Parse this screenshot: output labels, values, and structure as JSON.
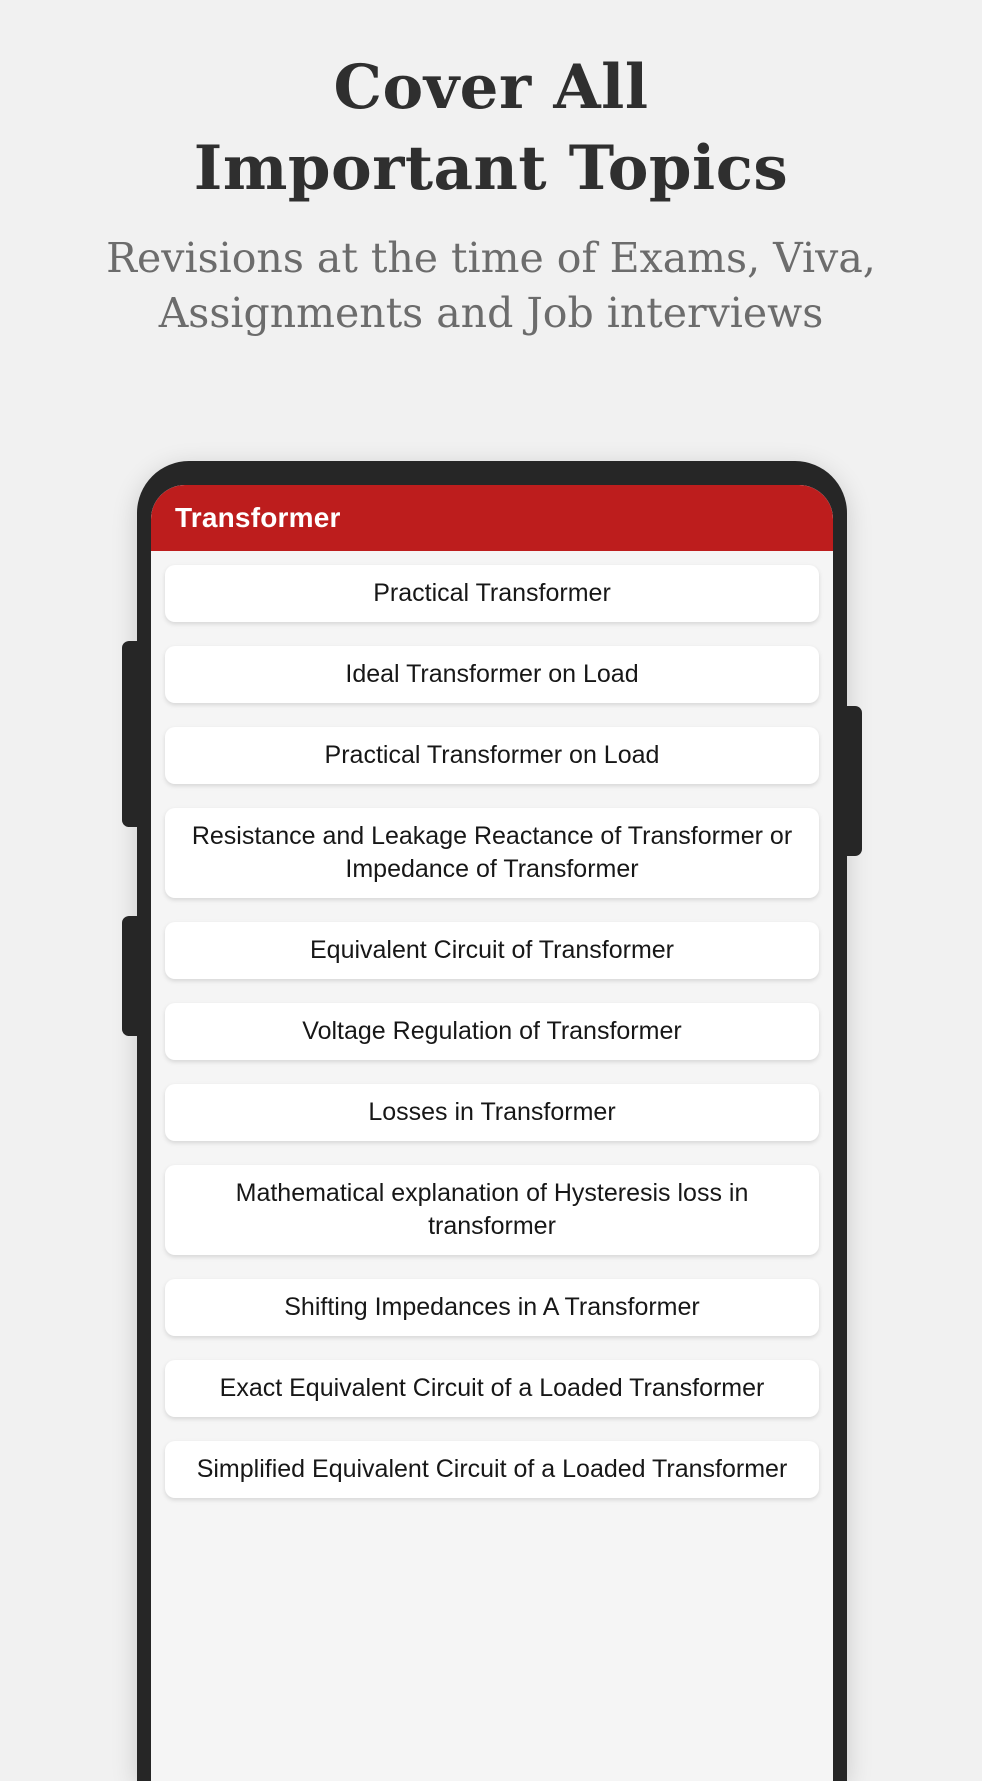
{
  "promo": {
    "title_lines": [
      "Cover All",
      "Important Topics"
    ],
    "subtitle_lines": [
      "Revisions at the time of Exams, Viva,",
      "Assignments and Job interviews"
    ],
    "title_color": "#2f2f2f",
    "subtitle_color": "#6c6c6c",
    "background_color": "#f1f1f1"
  },
  "phone": {
    "frame_color": "#262626",
    "screen_background": "#f5f5f5",
    "hardware_buttons": [
      {
        "name": "volume-up",
        "side": "left"
      },
      {
        "name": "volume-down",
        "side": "left"
      },
      {
        "name": "power",
        "side": "right"
      }
    ]
  },
  "app": {
    "appbar": {
      "title": "Transformer",
      "background_color": "#bd1d1d",
      "text_color": "#ffffff"
    },
    "topics": [
      {
        "label": "Practical Transformer"
      },
      {
        "label": "Ideal Transformer on Load"
      },
      {
        "label": "Practical Transformer on Load"
      },
      {
        "label": "Resistance and Leakage Reactance of Transformer or Impedance of Transformer"
      },
      {
        "label": "Equivalent Circuit of Transformer"
      },
      {
        "label": "Voltage Regulation of Transformer"
      },
      {
        "label": "Losses in Transformer"
      },
      {
        "label": "Mathematical explanation of Hysteresis loss in transformer"
      },
      {
        "label": "Shifting Impedances in A Transformer"
      },
      {
        "label": "Exact Equivalent Circuit of a Loaded Transformer"
      },
      {
        "label": "Simplified Equivalent Circuit of a Loaded Transformer"
      }
    ]
  }
}
